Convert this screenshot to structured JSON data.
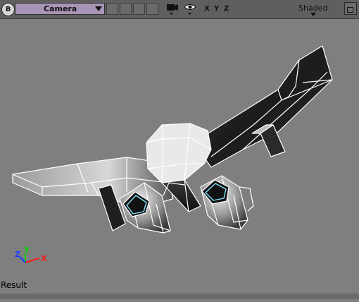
{
  "toolbar": {
    "b_button": "B",
    "camera_select": "Camera",
    "axis_x": "X",
    "axis_y": "Y",
    "axis_z": "Z",
    "shading_mode": "Shaded",
    "icons": [
      "camera-icon",
      "eye-icon",
      "maximize-icon"
    ]
  },
  "viewport": {
    "gizmo": {
      "z": "Z",
      "y": "Y",
      "x": "X"
    },
    "status": "Result",
    "colors": {
      "background": "#7f7f7f",
      "wireframe": "#ffffff",
      "intake_highlight": "#7fe6ff",
      "gizmo_z": "#1a3cff",
      "gizmo_y": "#00d000",
      "gizmo_x": "#ff1a1a"
    }
  }
}
